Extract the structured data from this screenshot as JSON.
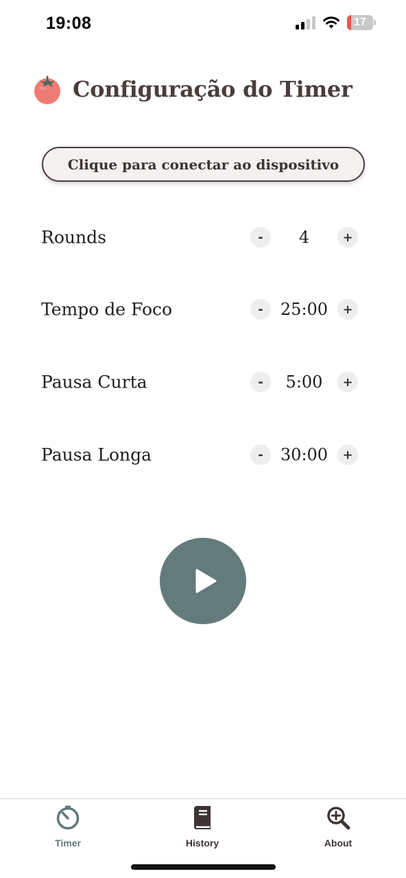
{
  "status_bar": {
    "time": "19:08",
    "battery_level": "17",
    "battery_fraction": 0.17,
    "battery_color": "#e45a4b",
    "icons": [
      "cellular-signal-icon",
      "wifi-icon",
      "battery-icon"
    ]
  },
  "header": {
    "icon": "tomato-icon",
    "title": "Configuração do Timer"
  },
  "connect_button": {
    "label": "Clique para conectar ao dispositivo"
  },
  "settings": [
    {
      "label": "Rounds",
      "value": "4",
      "minus": "-",
      "plus": "+"
    },
    {
      "label": "Tempo de Foco",
      "value": "25:00",
      "minus": "-",
      "plus": "+"
    },
    {
      "label": "Pausa Curta",
      "value": "5:00",
      "minus": "-",
      "plus": "+"
    },
    {
      "label": "Pausa Longa",
      "value": "30:00",
      "minus": "-",
      "plus": "+"
    }
  ],
  "play_button": {
    "icon": "play-icon",
    "color": "#637b7a"
  },
  "tab_bar": {
    "active_color": "#5f7878",
    "inactive_color": "#3d3434",
    "tabs": [
      {
        "label": "Timer",
        "icon": "timer-icon",
        "active": true
      },
      {
        "label": "History",
        "icon": "book-icon",
        "active": false
      },
      {
        "label": "About",
        "icon": "magnifier-plus-icon",
        "active": false
      }
    ]
  },
  "colors": {
    "title_text": "#4a3d3d",
    "tomato": "#ef7d76",
    "tomato_leaf": "#4f6a5f"
  }
}
